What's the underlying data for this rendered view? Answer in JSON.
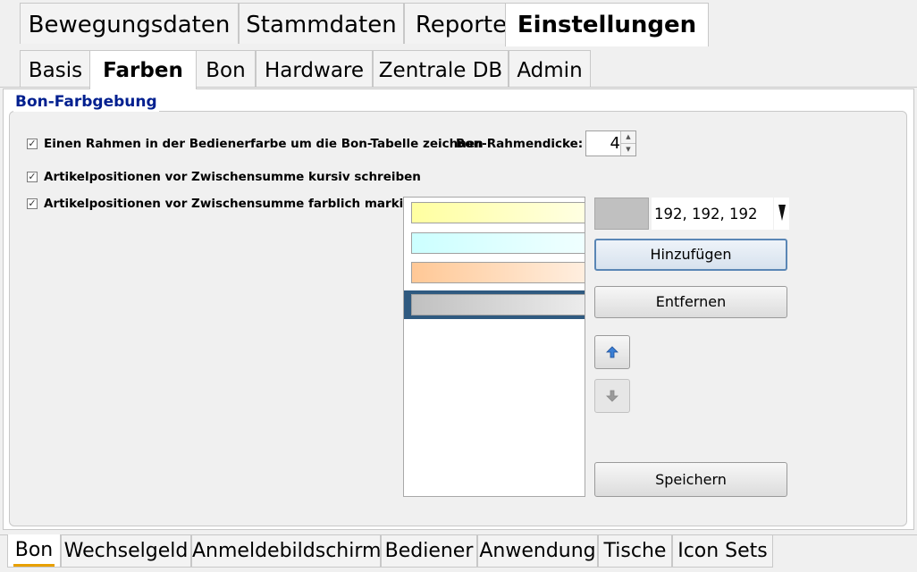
{
  "main_tabs": [
    "Bewegungsdaten",
    "Stammdaten",
    "Reporte",
    "Einstellungen"
  ],
  "main_tabs_active": "Einstellungen",
  "sub_tabs": [
    "Basis",
    "Farben",
    "Bon",
    "Hardware",
    "Zentrale DB",
    "Admin"
  ],
  "sub_tabs_active": "Farben",
  "group": {
    "title": "Bon-Farbgebung",
    "option_frame_label": "Einen Rahmen in der Bedienerfarbe um die Bon-Tabelle zeichnen",
    "option_frame_checked": true,
    "border_thickness_label": "Bon-Rahmendicke:",
    "border_thickness_value": "4",
    "option_italic_label": "Artikelpositionen vor Zwischensumme kursiv schreiben",
    "option_italic_checked": true,
    "option_color_label": "Artikelpositionen vor Zwischensumme farblich markieren",
    "option_color_checked": true
  },
  "color_list": {
    "colors": [
      "#ffffa0",
      "#ccffff",
      "#ffc896",
      "#c0c0c0"
    ],
    "selected_index": 3
  },
  "color_editor": {
    "swatch_color": "#c0c0c0",
    "value_text": "192, 192, 192"
  },
  "buttons": {
    "add": "Hinzufügen",
    "remove": "Entfernen",
    "save": "Speichern"
  },
  "icons": {
    "move_up": "arrow-up-icon",
    "move_down": "arrow-down-icon",
    "dropdown": "chevron-down-icon"
  },
  "bottom_tabs": [
    "Bon",
    "Wechselgeld",
    "Anmeldebildschirm",
    "Bediener",
    "Anwendung",
    "Tische",
    "Icon Sets"
  ],
  "bottom_tabs_active": "Bon"
}
